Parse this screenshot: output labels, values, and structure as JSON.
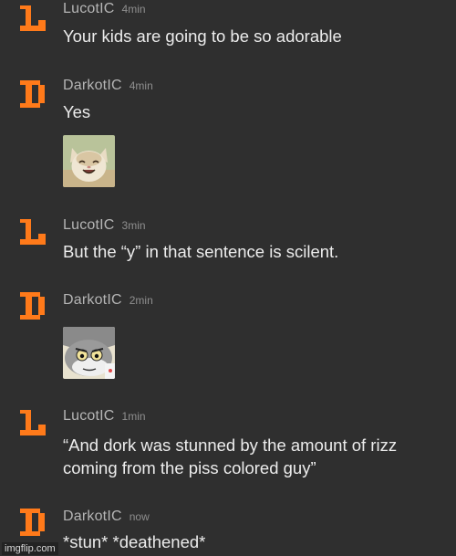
{
  "colors": {
    "background": "#2f2f2f",
    "avatar_orange": "#ff7a1a",
    "username": "#b5b5b5",
    "time": "#8f8f8f",
    "message_text": "#ececec"
  },
  "messages": [
    {
      "user": "LucotIC",
      "time": "4min",
      "avatar": "letter-l-avatar-icon",
      "text": "Your kids are going to be so adorable"
    },
    {
      "user": "DarkotIC",
      "time": "4min",
      "avatar": "letter-d-avatar-icon",
      "text": "Yes",
      "image": "smiling-cat-image"
    },
    {
      "user": "LucotIC",
      "time": "3min",
      "avatar": "letter-l-avatar-icon",
      "text": "But the “y” in that sentence is scilent."
    },
    {
      "user": "DarkotIC",
      "time": "2min",
      "avatar": "letter-d-avatar-icon",
      "image": "unsettled-tom-image"
    },
    {
      "user": "LucotIC",
      "time": "1min",
      "avatar": "letter-l-avatar-icon",
      "text_line1": "“And dork was stunned by the amount of rizz",
      "text_line2": "coming from the piss colored guy”"
    },
    {
      "user": "DarkotIC",
      "time": "now",
      "avatar": "letter-d-avatar-icon",
      "text": "*stun* *deathened*"
    }
  ],
  "watermark": "imgflip.com"
}
